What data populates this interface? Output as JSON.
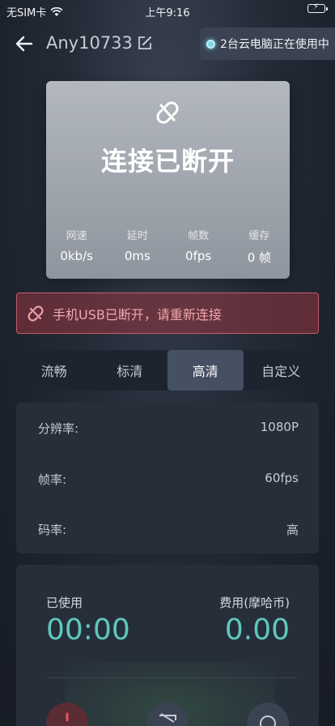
{
  "status_bar": {
    "carrier": "无SIM卡",
    "time": "上午9:16"
  },
  "header": {
    "title": "Any10733",
    "pc_badge": "2台云电脑正在使用中"
  },
  "status_card": {
    "title": "连接已断开",
    "stats": [
      {
        "label": "网速",
        "value": "0kb/s"
      },
      {
        "label": "延时",
        "value": "0ms"
      },
      {
        "label": "帧数",
        "value": "0fps"
      },
      {
        "label": "缓存",
        "value": "0 帧"
      }
    ]
  },
  "alert": {
    "text": "手机USB已断开，请重新连接"
  },
  "quality_tabs": {
    "items": [
      "流畅",
      "标清",
      "高清",
      "自定义"
    ],
    "active": "高清"
  },
  "settings": {
    "resolution": {
      "label": "分辨率:",
      "value": "1080P"
    },
    "framerate": {
      "label": "帧率:",
      "value": "60fps"
    },
    "bitrate": {
      "label": "码率:",
      "value": "高"
    }
  },
  "usage": {
    "used_label": "已使用",
    "used_value": "00:00",
    "cost_label": "费用(摩哈币)",
    "cost_value": "0.00"
  },
  "colors": {
    "accent": "#5fc8bd",
    "alert": "#f1a7ac",
    "badge_dot": "#7fd6e2"
  }
}
